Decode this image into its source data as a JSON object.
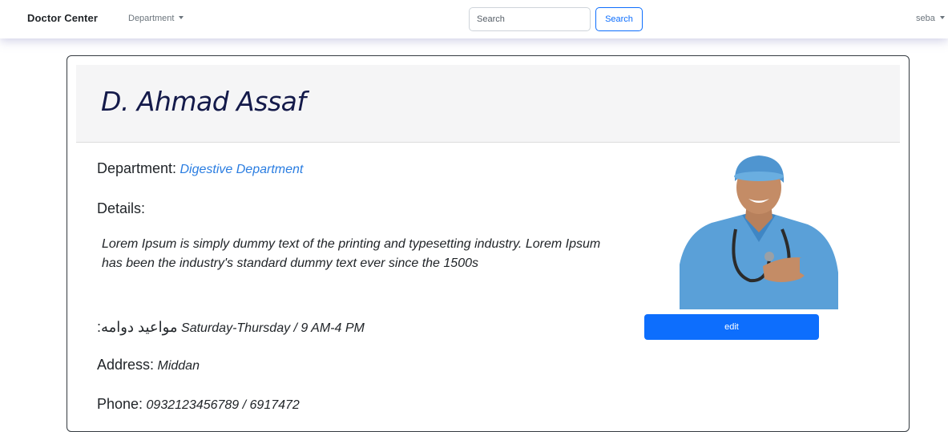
{
  "navbar": {
    "brand": "Doctor Center",
    "department_menu": "Department",
    "search": {
      "placeholder": "Search",
      "value": ""
    },
    "search_button": "Search",
    "user": "seba"
  },
  "doctor": {
    "name": "D. Ahmad Assaf",
    "department_label": "Department:",
    "department_value": "Digestive Department",
    "details_label": "Details:",
    "details_text": "Lorem Ipsum is simply dummy text of the printing and typesetting industry. Lorem Ipsum has been the industry's standard dummy text ever since the 1500s",
    "hours_label": "مواعيد دوامه:",
    "hours_value": "Saturday-Thursday / 9 AM-4 PM",
    "address_label": "Address:",
    "address_value": "Middan",
    "phone_label": "Phone:",
    "phone_value": "0932123456789 / 6917472",
    "edit_button": "edit"
  },
  "colors": {
    "primary": "#0d6efd",
    "link": "#2a7de1",
    "name": "#141a4a",
    "scrub_blue": "#5aa0d8"
  },
  "icons": [
    "caret-down-icon",
    "caret-down-icon"
  ]
}
